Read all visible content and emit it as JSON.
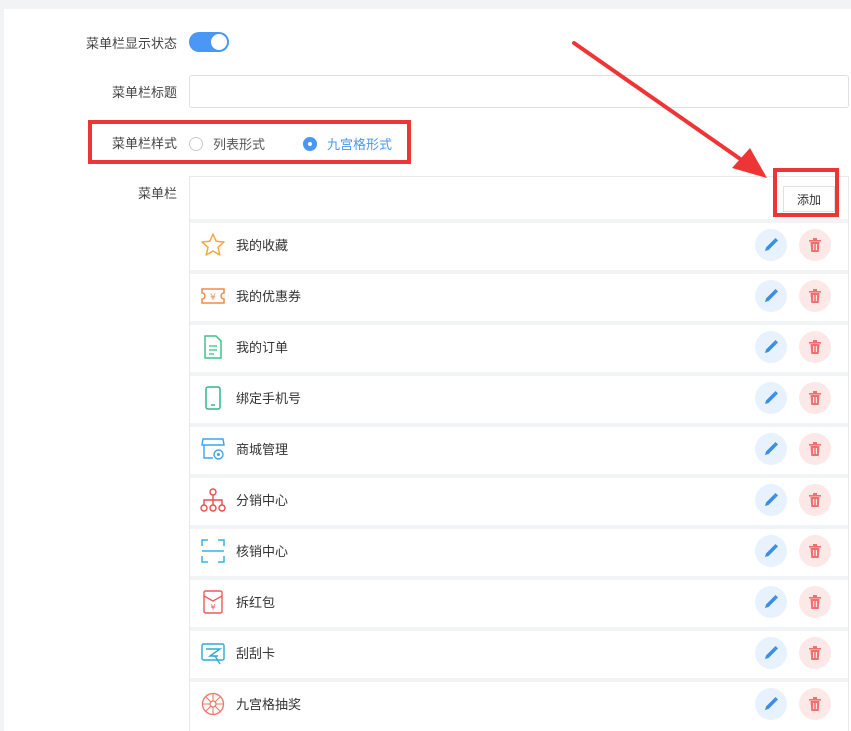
{
  "form": {
    "display_label": "菜单栏显示状态",
    "title_label": "菜单栏标题",
    "title_value": "",
    "title_placeholder": "",
    "style_label": "菜单栏样式",
    "style_options": [
      "列表形式",
      "九宫格形式"
    ],
    "style_selected": "九宫格形式",
    "menu_label": "菜单栏",
    "add_label": "添加"
  },
  "colors": {
    "accent": "#4a97f5",
    "annotation": "#ee3535",
    "delete": "#f07070"
  },
  "menu_items": [
    {
      "name": "我的收藏",
      "icon": "star-icon"
    },
    {
      "name": "我的优惠券",
      "icon": "coupon-icon"
    },
    {
      "name": "我的订单",
      "icon": "order-icon"
    },
    {
      "name": "绑定手机号",
      "icon": "phone-icon"
    },
    {
      "name": "商城管理",
      "icon": "store-settings-icon"
    },
    {
      "name": "分销中心",
      "icon": "distribution-icon"
    },
    {
      "name": "核销中心",
      "icon": "scan-icon"
    },
    {
      "name": "拆红包",
      "icon": "red-envelope-icon"
    },
    {
      "name": "刮刮卡",
      "icon": "scratch-card-icon"
    },
    {
      "name": "九宫格抽奖",
      "icon": "lottery-wheel-icon"
    }
  ]
}
